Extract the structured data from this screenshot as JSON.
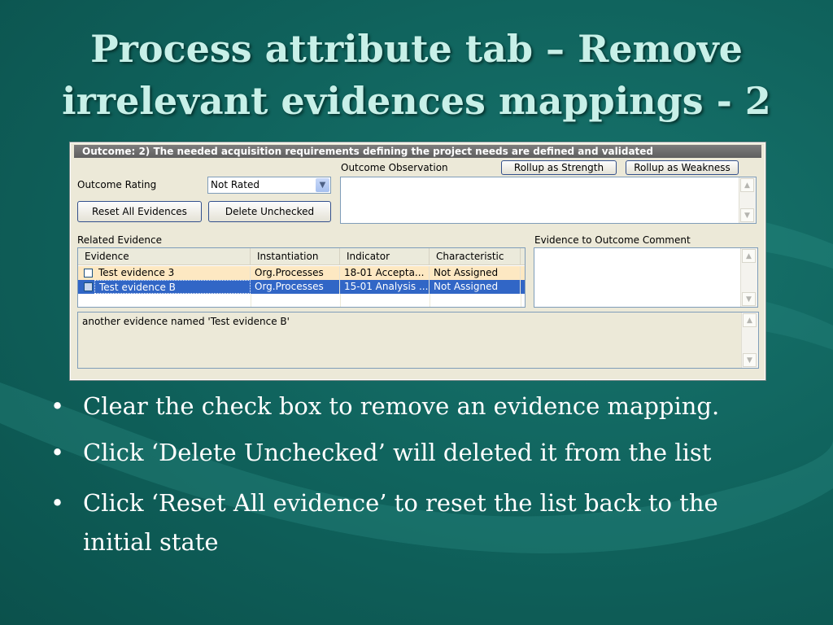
{
  "slide": {
    "title_line1": "Process attribute tab – Remove",
    "title_line2": "irrelevant evidences mappings - 2"
  },
  "panel": {
    "header": "Outcome: 2) The needed acquisition requirements defining the project needs are defined and validated",
    "outcome_rating_label": "Outcome Rating",
    "outcome_rating_value": "Not Rated",
    "outcome_observation_label": "Outcome Observation",
    "rollup_strength_label": "Rollup as Strength",
    "rollup_weakness_label": "Rollup as Weakness",
    "reset_all_label": "Reset All Evidences",
    "delete_unchecked_label": "Delete Unchecked",
    "related_evidence_label": "Related Evidence",
    "evidence_comment_label": "Evidence to Outcome Comment",
    "columns": [
      "Evidence",
      "Instantiation",
      "Indicator",
      "Characteristic"
    ],
    "rows": [
      {
        "evidence": "Test evidence 3",
        "instantiation": "Org.Processes",
        "indicator": "18-01 Accepta...",
        "characteristic": "Not Assigned",
        "checked": false,
        "selected": false
      },
      {
        "evidence": "Test evidence B",
        "instantiation": "Org.Processes",
        "indicator": "15-01 Analysis ...",
        "characteristic": "Not Assigned",
        "checked": false,
        "selected": true
      }
    ],
    "description": "another evidence named 'Test evidence B'"
  },
  "bullets": [
    "Clear the check box to remove an evidence mapping.",
    "Click ‘Delete Unchecked’ will deleted it from the list",
    "Click ‘Reset All evidence’ to reset the list back to the initial state"
  ],
  "icons": {
    "dropdown": "chevron-down-icon",
    "scroll_up": "chevron-up-icon",
    "scroll_down": "chevron-down-icon",
    "bullet": "bullet-dot-icon"
  },
  "colors": {
    "background": "#0f615b",
    "title": "#c8f0e8",
    "selection": "#3166c6",
    "highlight_row": "#fde8c2"
  }
}
